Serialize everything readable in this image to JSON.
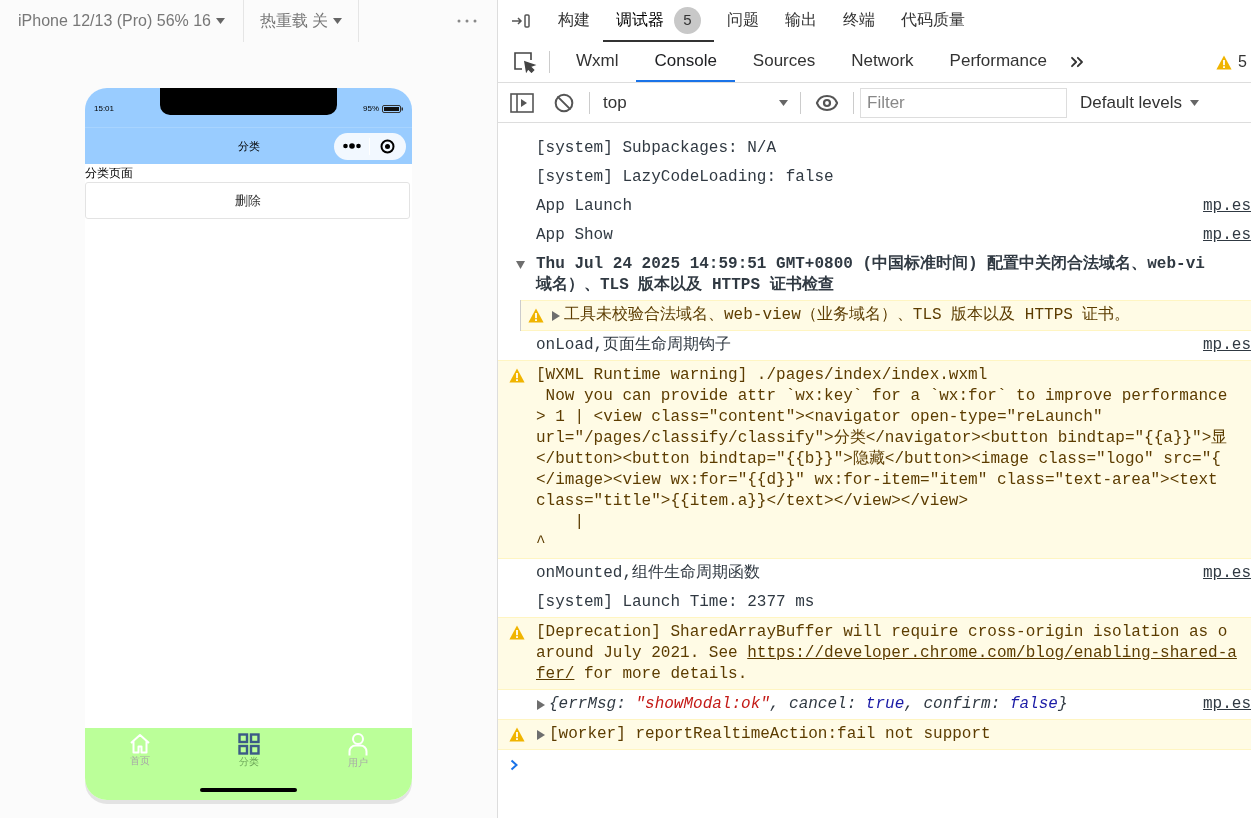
{
  "simulator": {
    "device": "iPhone 12/13 (Pro) 56% 16",
    "hot_reload": "热重载 关",
    "phone": {
      "time": "15:01",
      "battery": "95%",
      "nav_title": "分类",
      "page_text": "分类页面",
      "button": "删除",
      "tabbar": [
        {
          "label": "首页",
          "kind": "home",
          "selected": false
        },
        {
          "label": "分类",
          "kind": "grid",
          "selected": true
        },
        {
          "label": "用户",
          "kind": "user",
          "selected": false
        }
      ]
    }
  },
  "devtools": {
    "top_tabs": [
      {
        "label": "构建",
        "selected": false
      },
      {
        "label": "调试器",
        "selected": true,
        "badge": "5"
      },
      {
        "label": "问题",
        "selected": false
      },
      {
        "label": "输出",
        "selected": false
      },
      {
        "label": "终端",
        "selected": false
      },
      {
        "label": "代码质量",
        "selected": false
      }
    ],
    "panel_tabs": [
      {
        "label": "Wxml",
        "selected": false
      },
      {
        "label": "Console",
        "selected": true
      },
      {
        "label": "Sources",
        "selected": false
      },
      {
        "label": "Network",
        "selected": false
      },
      {
        "label": "Performance",
        "selected": false
      }
    ],
    "warning_count": "5",
    "context": "top",
    "filter": {
      "placeholder": "Filter"
    },
    "levels": "Default levels",
    "console": [
      {
        "kind": "log",
        "lines": [
          "[system] Subpackages: N/A"
        ]
      },
      {
        "kind": "log",
        "lines": [
          "[system] LazyCodeLoading: false"
        ]
      },
      {
        "kind": "log",
        "lines": [
          "App Launch"
        ],
        "source": "mp.es"
      },
      {
        "kind": "log",
        "lines": [
          "App Show"
        ],
        "source": "mp.es"
      },
      {
        "kind": "group",
        "expanded": true,
        "lines": [
          "Thu Jul 24 2025 14:59:51 GMT+0800 (中国标准时间) 配置中关闭合法域名、web-vi",
          "域名）、TLS 版本以及 HTTPS 证书检查"
        ],
        "children": [
          {
            "kind": "warning",
            "expanded": false,
            "lines": [
              "工具未校验合法域名、web-view（业务域名）、TLS 版本以及 HTTPS 证书。"
            ]
          }
        ]
      },
      {
        "kind": "log",
        "lines": [
          "onLoad,页面生命周期钩子"
        ],
        "source": "mp.es"
      },
      {
        "kind": "warning",
        "lines": [
          "[WXML Runtime warning] ./pages/index/index.wxml",
          " Now you can provide attr `wx:key` for a `wx:for` to improve performance",
          "> 1 | <view class=\"content\"><navigator open-type=\"reLaunch\"",
          "url=\"/pages/classify/classify\">分类</navigator><button bindtap=\"{{a}}\">显",
          "</button><button bindtap=\"{{b}}\">隐藏</button><image class=\"logo\" src=\"{",
          "</image><view wx:for=\"{{d}}\" wx:for-item=\"item\" class=\"text-area\"><text",
          "class=\"title\">{{item.a}}</text></view></view>",
          "    |",
          "^"
        ]
      },
      {
        "kind": "log",
        "lines": [
          "onMounted,组件生命周期函数"
        ],
        "source": "mp.es"
      },
      {
        "kind": "log",
        "lines": [
          "[system] Launch Time: 2377 ms"
        ]
      },
      {
        "kind": "warning",
        "lines": [
          "[Deprecation] SharedArrayBuffer will require cross-origin isolation as o",
          [
            {
              "kind": "text",
              "text": "around July 2021. See "
            },
            {
              "kind": "link",
              "text": "https://developer.chrome.com/blog/enabling-shared-a"
            }
          ],
          [
            {
              "kind": "link",
              "text": "fer/"
            },
            {
              "kind": "text",
              "text": " for more details."
            }
          ]
        ]
      },
      {
        "kind": "object",
        "expanded": false,
        "source": "mp.es",
        "lines": [
          [
            {
              "kind": "text",
              "text": "{errMsg: "
            },
            {
              "kind": "string",
              "text": "\"showModal:ok\""
            },
            {
              "kind": "text",
              "text": ", cancel: "
            },
            {
              "kind": "boolean",
              "text": "true"
            },
            {
              "kind": "text",
              "text": ", confirm: "
            },
            {
              "kind": "boolean",
              "text": "false"
            },
            {
              "kind": "text",
              "text": "}"
            }
          ]
        ]
      },
      {
        "kind": "warning",
        "expanded": false,
        "lines": [
          "[worker] reportRealtimeAction:fail not support"
        ]
      }
    ]
  }
}
